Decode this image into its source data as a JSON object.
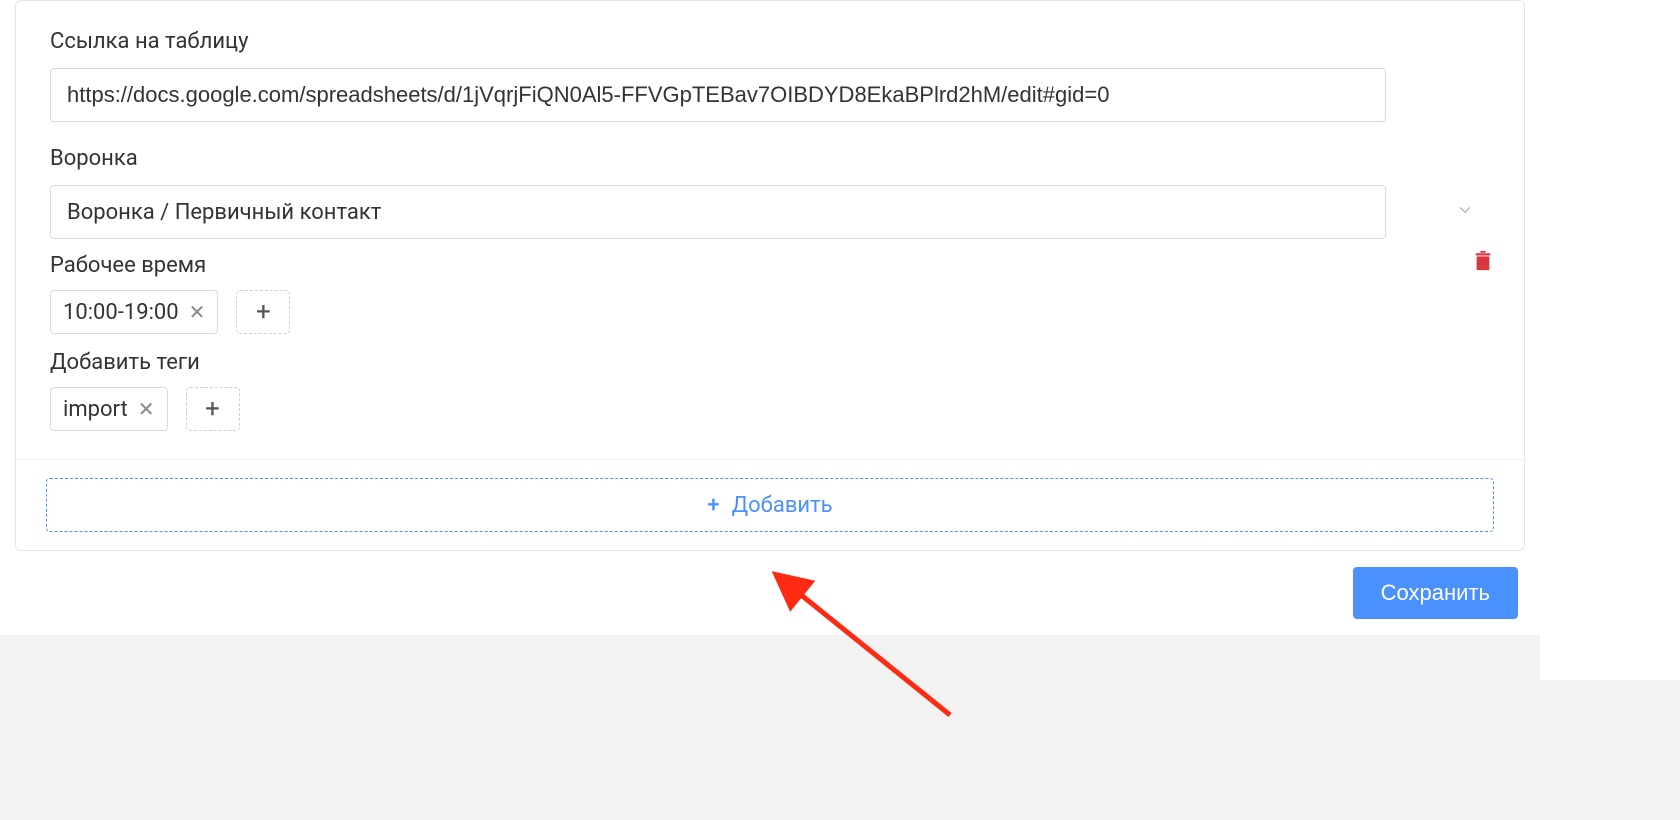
{
  "labels": {
    "sheet_link": "Ссылка на таблицу",
    "funnel": "Воронка",
    "work_hours": "Рабочее время",
    "add_tags": "Добавить теги"
  },
  "sheet_link": {
    "value": "https://docs.google.com/spreadsheets/d/1jVqrjFiQN0Al5-FFVGpTEBav7OIBDYD8EkaBPlrd2hM/edit#gid=0"
  },
  "funnel": {
    "selected": "Воронка / Первичный контакт"
  },
  "work_hours": {
    "chips": [
      "10:00-19:00"
    ]
  },
  "tags": {
    "chips": [
      "import"
    ]
  },
  "buttons": {
    "add_big": "Добавить",
    "save": "Сохранить"
  }
}
